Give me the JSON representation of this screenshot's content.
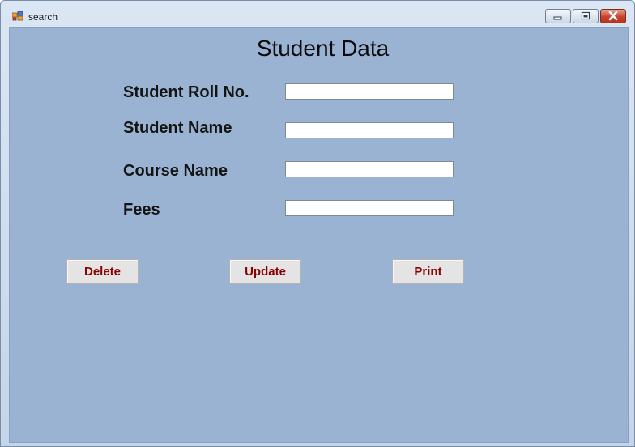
{
  "window": {
    "title": "search",
    "icon": "form-app-icon",
    "controls": {
      "minimize_icon": "minimize-icon",
      "maximize_icon": "restore-icon",
      "close_icon": "close-icon"
    }
  },
  "form": {
    "heading": "Student Data",
    "fields": [
      {
        "label": "Student Roll No.",
        "value": "",
        "placeholder": ""
      },
      {
        "label": "Student Name",
        "value": "",
        "placeholder": ""
      },
      {
        "label": "Course Name",
        "value": "",
        "placeholder": ""
      },
      {
        "label": "Fees",
        "value": "",
        "placeholder": ""
      }
    ],
    "buttons": {
      "delete": "Delete",
      "update": "Update",
      "print": "Print"
    }
  },
  "colors": {
    "form_background": "#9bb3d2",
    "button_text": "#8b0000",
    "button_face": "#e4e4e4"
  }
}
